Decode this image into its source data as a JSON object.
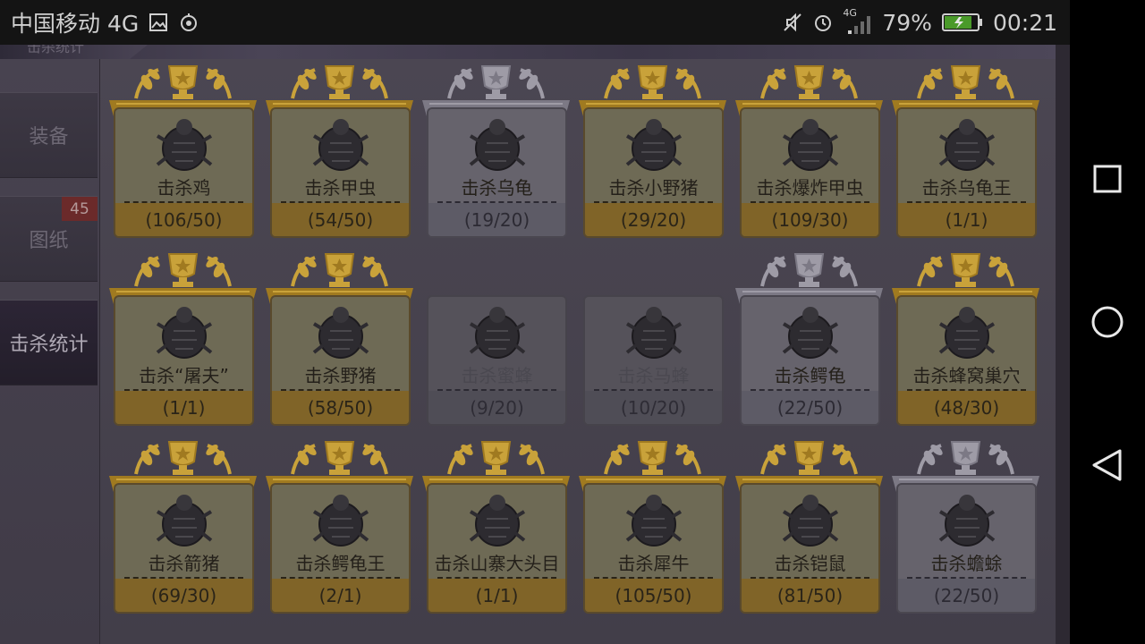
{
  "status_bar": {
    "carrier": "中国移动 4G",
    "network_small": "4G",
    "battery": "79%",
    "time": "00:21"
  },
  "top_tab": {
    "label": "击杀统计"
  },
  "sidebar": {
    "items": [
      {
        "label": "装备",
        "badge": ""
      },
      {
        "label": "图纸",
        "badge": "45"
      },
      {
        "label": "击杀统计",
        "badge": ""
      }
    ]
  },
  "cards": [
    {
      "name": "击杀鸡",
      "count": "(106/50)",
      "medal": "gold",
      "icon": "chicken-icon"
    },
    {
      "name": "击杀甲虫",
      "count": "(54/50)",
      "medal": "gold",
      "icon": "beetle-icon"
    },
    {
      "name": "击杀乌龟",
      "count": "(19/20)",
      "medal": "silver",
      "icon": "turtle-icon"
    },
    {
      "name": "击杀小野猪",
      "count": "(29/20)",
      "medal": "gold",
      "icon": "boar-icon"
    },
    {
      "name": "击杀爆炸甲虫",
      "count": "(109/30)",
      "medal": "gold",
      "icon": "bomb-beetle-icon"
    },
    {
      "name": "击杀乌龟王",
      "count": "(1/1)",
      "medal": "gold",
      "icon": "turtle-king-icon"
    },
    {
      "name": "击杀“屠夫”",
      "count": "(1/1)",
      "medal": "gold",
      "icon": "butcher-icon"
    },
    {
      "name": "击杀野猪",
      "count": "(58/50)",
      "medal": "gold",
      "icon": "wild-boar-icon"
    },
    {
      "name": "击杀蜜蜂",
      "count": "(9/20)",
      "medal": "none",
      "icon": "bee-icon"
    },
    {
      "name": "击杀马蜂",
      "count": "(10/20)",
      "medal": "none",
      "icon": "wasp-icon"
    },
    {
      "name": "击杀鳄龟",
      "count": "(22/50)",
      "medal": "silver",
      "icon": "snapping-turtle-icon"
    },
    {
      "name": "击杀蜂窝巢穴",
      "count": "(48/30)",
      "medal": "gold",
      "icon": "hive-icon"
    },
    {
      "name": "击杀箭猪",
      "count": "(69/30)",
      "medal": "gold",
      "icon": "porcupine-icon"
    },
    {
      "name": "击杀鳄龟王",
      "count": "(2/1)",
      "medal": "gold",
      "icon": "snapping-turtle-king-icon"
    },
    {
      "name": "击杀山寨大头目",
      "count": "(1/1)",
      "medal": "gold",
      "icon": "bandit-boss-icon"
    },
    {
      "name": "击杀犀牛",
      "count": "(105/50)",
      "medal": "gold",
      "icon": "rhino-icon"
    },
    {
      "name": "击杀铠鼠",
      "count": "(81/50)",
      "medal": "gold",
      "icon": "armadillo-icon"
    },
    {
      "name": "击杀蟾蜍",
      "count": "(22/50)",
      "medal": "silver",
      "icon": "toad-icon"
    }
  ],
  "colors": {
    "gold": "#806428",
    "silver": "#5d5b66",
    "badge": "#6b2a2a"
  }
}
